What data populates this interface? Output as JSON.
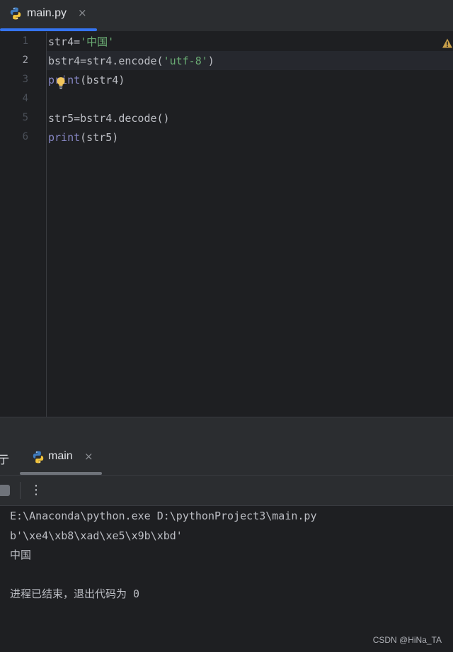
{
  "tab": {
    "filename": "main.py",
    "close_glyph": "×",
    "icon": "python-icon"
  },
  "editor": {
    "current_line": 2,
    "lines": [
      {
        "num": "1",
        "code": "str4='中国'"
      },
      {
        "num": "2",
        "code": "bstr4=str4.encode('utf-8')"
      },
      {
        "num": "3",
        "code": "print(bstr4)"
      },
      {
        "num": "4",
        "code": ""
      },
      {
        "num": "5",
        "code": "str5=bstr4.decode()"
      },
      {
        "num": "6",
        "code": "print(str5)"
      }
    ],
    "icons": [
      "lightbulb-icon",
      "warning-icon"
    ]
  },
  "run_panel": {
    "title_fragment": "亍",
    "tab_label": "main",
    "close_glyph": "×",
    "more_glyph": "⋮"
  },
  "console": {
    "lines": [
      "E:\\Anaconda\\python.exe D:\\pythonProject3\\main.py",
      "b'\\xe4\\xb8\\xad\\xe5\\x9b\\xbd'",
      "中国",
      "",
      "进程已结束，退出代码为 0"
    ]
  },
  "watermark": "CSDN @HiNa_TA",
  "colors": {
    "background": "#1e1f22",
    "panel": "#2b2d30",
    "accent": "#3574f0",
    "keyword": "#8888c6",
    "string": "#6aab73",
    "text": "#bcbec4"
  }
}
